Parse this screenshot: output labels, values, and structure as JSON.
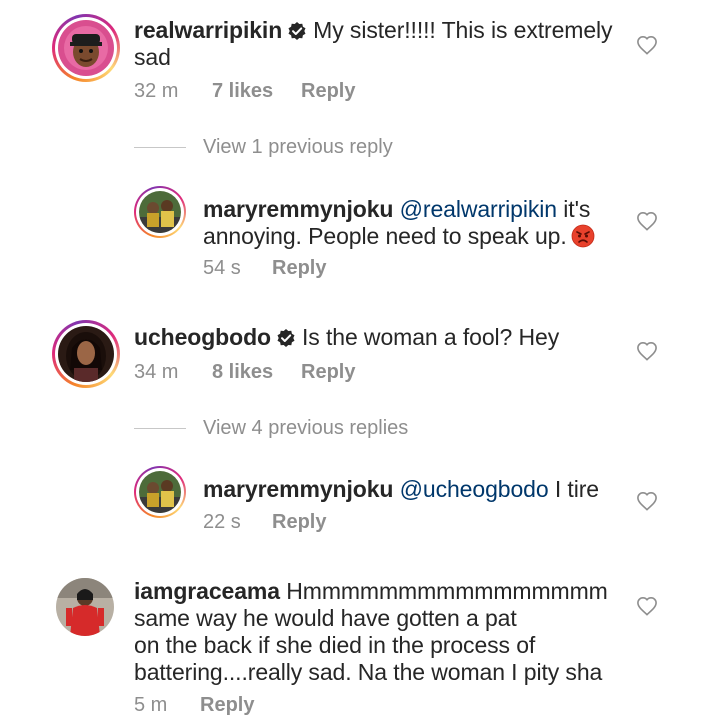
{
  "comments": [
    {
      "username": "realwarripikin",
      "verified": true,
      "text": "My sister!!!!! This is extremely",
      "text_line2": "sad",
      "time": "32 m",
      "likes": "7 likes",
      "reply": "Reply",
      "view_replies": "View 1 previous reply",
      "replies": [
        {
          "username": "maryremmynjoku",
          "mention": "@realwarripikin",
          "text": " it's",
          "text_line2": "annoying. People need to speak up.",
          "emoji": "angry-face",
          "time": "54 s",
          "reply": "Reply"
        }
      ]
    },
    {
      "username": "ucheogbodo",
      "verified": true,
      "text": "Is the woman a fool? Hey",
      "time": "34 m",
      "likes": "8 likes",
      "reply": "Reply",
      "view_replies": "View 4 previous replies",
      "replies": [
        {
          "username": "maryremmynjoku",
          "mention": "@ucheogbodo",
          "text": " I tire",
          "time": "22 s",
          "reply": "Reply"
        }
      ]
    },
    {
      "username": "iamgraceama",
      "verified": false,
      "text": "Hmmmmmmmmmmmmmmmm",
      "lines": [
        "same way he would have gotten a pat",
        "on the back if she died in the process of",
        "battering....really sad. Na the woman I pity sha"
      ],
      "time": "5 m",
      "reply": "Reply"
    }
  ],
  "icons": {
    "like": "heart-outline-icon",
    "verified": "verified-badge-icon"
  },
  "colors": {
    "text": "#262626",
    "meta": "#8e8e8e",
    "mention": "#00376b",
    "verified": "#3897f0"
  }
}
